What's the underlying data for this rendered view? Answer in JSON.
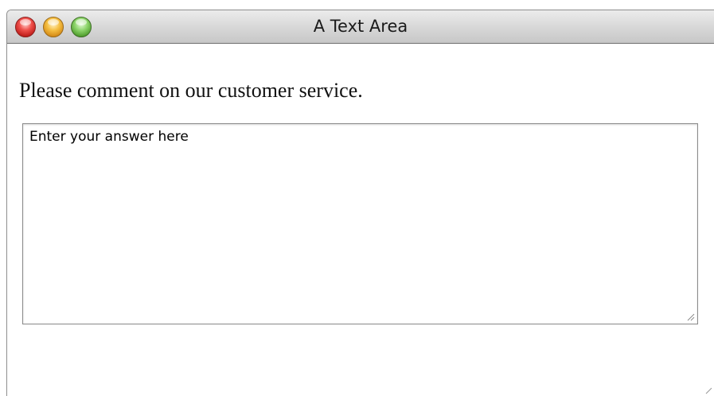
{
  "window": {
    "title": "A Text Area"
  },
  "form": {
    "prompt": "Please comment on our customer service.",
    "textarea_value": "Enter your answer here"
  },
  "icons": {
    "close": "close-icon",
    "minimize": "minimize-icon",
    "zoom": "zoom-icon",
    "textarea_resize": "resize-grip-icon",
    "window_resize": "window-resize-grip-icon"
  },
  "colors": {
    "close": "#f0524d",
    "minimize": "#f5bf42",
    "zoom": "#8ed56c"
  }
}
